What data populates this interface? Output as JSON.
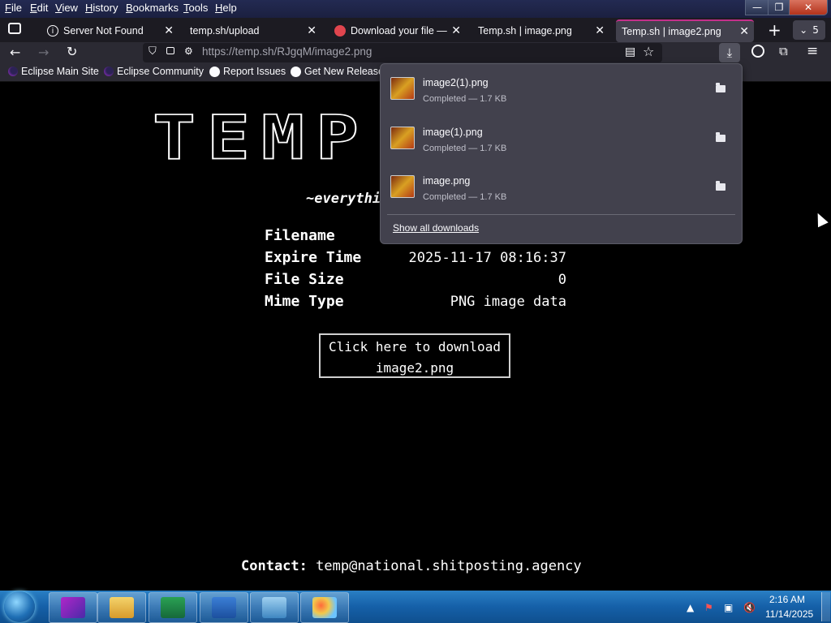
{
  "menu": {
    "items": [
      "File",
      "Edit",
      "View",
      "History",
      "Bookmarks",
      "Tools",
      "Help"
    ]
  },
  "window_controls": {
    "minimize": "—",
    "maximize": "❐",
    "close": "✕"
  },
  "tabs": [
    {
      "label": "Server Not Found",
      "icon": "info-icon",
      "active": false
    },
    {
      "label": "temp.sh/upload",
      "icon": "",
      "active": false
    },
    {
      "label": "Download your file — t",
      "icon": "firefox-alert-icon",
      "active": false
    },
    {
      "label": "Temp.sh | image.png",
      "icon": "",
      "active": false
    },
    {
      "label": "Temp.sh | image2.png",
      "icon": "",
      "active": true
    }
  ],
  "tab_overflow_count": "5",
  "navbar": {
    "url": "https://temp.sh/RJgqM/image2.png"
  },
  "bookmarks": [
    {
      "label": "Eclipse Main Site",
      "icon": "eclipse-icon"
    },
    {
      "label": "Eclipse Community",
      "icon": "eclipse-icon"
    },
    {
      "label": "Report Issues",
      "icon": "github-icon"
    },
    {
      "label": "Get New Releases",
      "icon": "github-icon"
    }
  ],
  "page": {
    "logo": "TEMP",
    "tagline": "~everything",
    "rows": [
      {
        "label": "Filename",
        "value": ""
      },
      {
        "label": "Expire Time",
        "value": "2025-11-17 08:16:37"
      },
      {
        "label": "File Size",
        "value": "0"
      },
      {
        "label": "Mime Type",
        "value": "PNG image data"
      }
    ],
    "download_line1": "Click here to download",
    "download_line2": "image2.png",
    "contact_label": "Contact:",
    "contact_email": "temp@national.shitposting.agency"
  },
  "downloads_panel": {
    "items": [
      {
        "name": "image2(1).png",
        "status": "Completed — 1.7 KB"
      },
      {
        "name": "image(1).png",
        "status": "Completed — 1.7 KB"
      },
      {
        "name": "image.png",
        "status": "Completed — 1.7 KB"
      }
    ],
    "show_all": "Show all downloads"
  },
  "taskbar": {
    "time": "2:16 AM",
    "date": "11/14/2025"
  },
  "colors": {
    "chrome_dark": "#1c1b22",
    "toolbar": "#2b2a33",
    "panel": "#42414d",
    "active_tab_accent": "#c42f8a",
    "taskbar_blue": "#1560a8"
  }
}
